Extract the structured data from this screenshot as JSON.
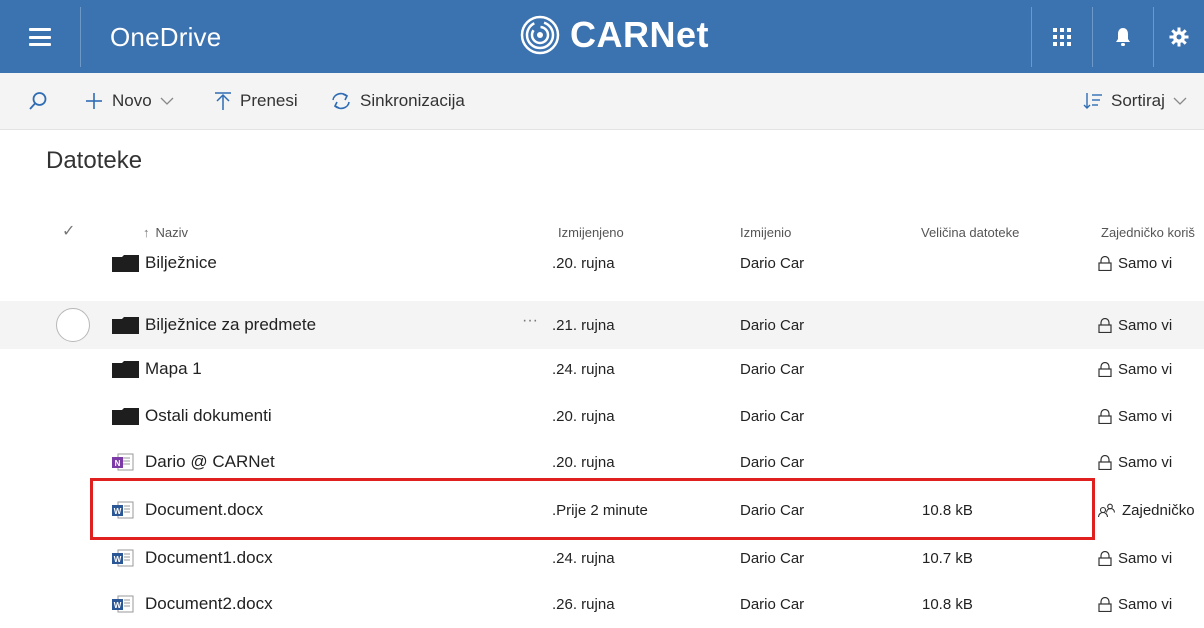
{
  "header": {
    "app_name": "OneDrive",
    "brand": "CARNet",
    "icons": [
      "hamburger-icon",
      "app-launcher-icon",
      "bell-icon",
      "gear-icon"
    ],
    "color": "#3b72b0"
  },
  "commands": {
    "search_icon": "search-icon",
    "new": "Novo",
    "upload": "Prenesi",
    "sync": "Sinkronizacija",
    "sort": "Sortiraj"
  },
  "page_title": "Datoteke",
  "columns": {
    "name": "Naziv",
    "modified": "Izmijenjeno",
    "modified_by": "Izmijenio",
    "size": "Veličina datoteke",
    "sharing": "Zajedničko koriš"
  },
  "rows": [
    {
      "icon": "folder-icon",
      "name": "Bilježnice",
      "modified": ".20. rujna",
      "modified_by": "Dario Car",
      "size": "",
      "sharing": "Samo vi",
      "sharing_icon": "lock-icon"
    },
    {
      "icon": "folder-icon",
      "name": "Bilježnice za predmete",
      "modified": ".21. rujna",
      "modified_by": "Dario Car",
      "size": "",
      "sharing": "Samo vi",
      "sharing_icon": "lock-icon"
    },
    {
      "icon": "folder-icon",
      "name": "Mapa 1",
      "modified": ".24. rujna",
      "modified_by": "Dario Car",
      "size": "",
      "sharing": "Samo vi",
      "sharing_icon": "lock-icon"
    },
    {
      "icon": "folder-icon",
      "name": "Ostali dokumenti",
      "modified": ".20. rujna",
      "modified_by": "Dario Car",
      "size": "",
      "sharing": "Samo vi",
      "sharing_icon": "lock-icon"
    },
    {
      "icon": "onenote-icon",
      "name": "Dario @ CARNet",
      "modified": ".20. rujna",
      "modified_by": "Dario Car",
      "size": "",
      "sharing": "Samo vi",
      "sharing_icon": "lock-icon"
    },
    {
      "icon": "word-icon",
      "name": "Document.docx",
      "modified": ".Prije 2 minute",
      "modified_by": "Dario Car",
      "size": "10.8 kB",
      "sharing": "Zajedničko",
      "sharing_icon": "people-icon"
    },
    {
      "icon": "word-icon",
      "name": "Document1.docx",
      "modified": ".24. rujna",
      "modified_by": "Dario Car",
      "size": "10.7 kB",
      "sharing": "Samo vi",
      "sharing_icon": "lock-icon"
    },
    {
      "icon": "word-icon",
      "name": "Document2.docx",
      "modified": ".26. rujna",
      "modified_by": "Dario Car",
      "size": "10.8 kB",
      "sharing": "Samo vi",
      "sharing_icon": "lock-icon"
    }
  ],
  "more_actions": "···"
}
